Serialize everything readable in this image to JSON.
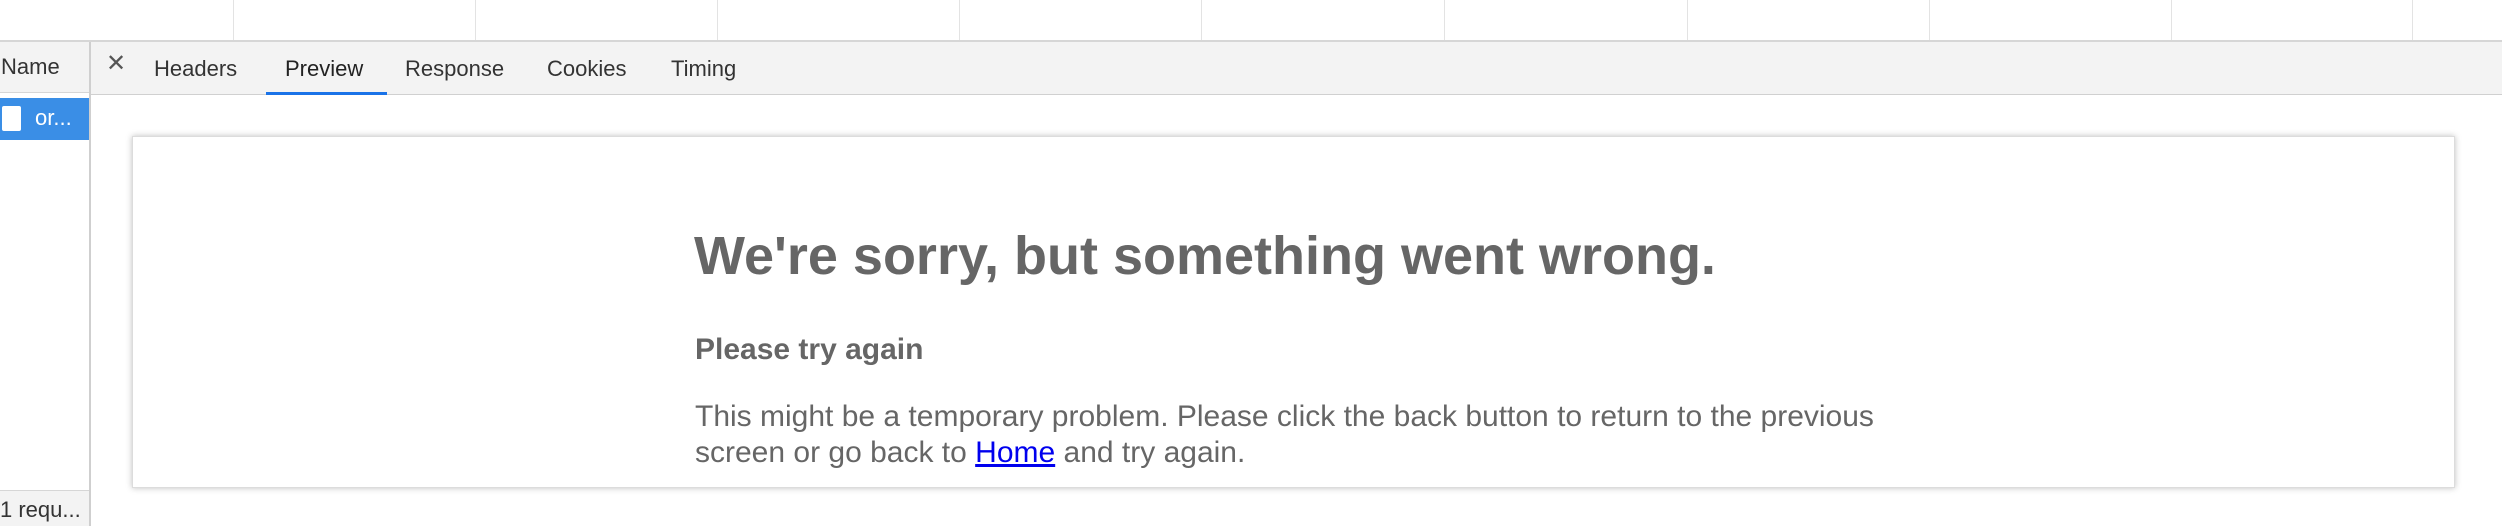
{
  "request_list": {
    "name_header": "Name",
    "selected_request": "or...",
    "footer": "1 requ..."
  },
  "tabs": [
    {
      "label": "Headers"
    },
    {
      "label": "Preview",
      "active": true
    },
    {
      "label": "Response"
    },
    {
      "label": "Cookies"
    },
    {
      "label": "Timing"
    }
  ],
  "icons": {
    "close": "close-icon",
    "file": "document-icon"
  },
  "preview": {
    "title": "We're sorry, but something went wrong.",
    "subtitle": "Please try again",
    "body_before_link": "This might be a temporary problem. Please click the back button to return to the previous screen or go back to ",
    "link_text": "Home",
    "body_after_link": " and try again."
  },
  "colors": {
    "selection": "#3a8ee6",
    "active_tab_underline": "#1a73e8",
    "link": "#0000ee",
    "error_text": "#666666"
  }
}
